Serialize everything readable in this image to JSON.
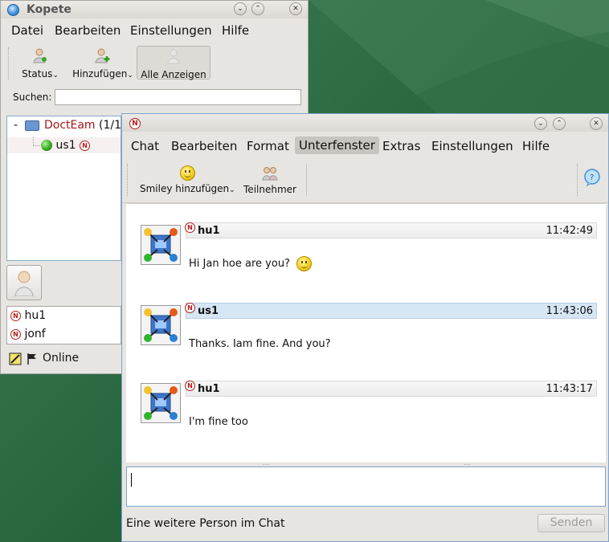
{
  "kopete": {
    "title": "Kopete",
    "menu": [
      "Datei",
      "Bearbeiten",
      "Einstellungen",
      "Hilfe"
    ],
    "toolbar": {
      "status": "Status",
      "add": "Hinzufügen",
      "show_all": "Alle Anzeigen"
    },
    "search_label": "Suchen:",
    "search_value": "",
    "group": {
      "expander": "-",
      "name": "DoctEam",
      "count": "(1/1)"
    },
    "contact": {
      "name": "us1"
    },
    "identities": [
      "hu1",
      "jonf"
    ],
    "status_text": "Online"
  },
  "chat": {
    "menu": [
      "Chat",
      "Bearbeiten",
      "Format",
      "Unterfenster",
      "Extras",
      "Einstellungen",
      "Hilfe"
    ],
    "active_menu": "Unterfenster",
    "toolbar": {
      "smiley": "Smiley hinzufügen",
      "participants": "Teilnehmer"
    },
    "messages": [
      {
        "sender": "hu1",
        "time": "11:42:49",
        "text": "Hi Jan hoe are you?",
        "has_smiley": true
      },
      {
        "sender": "us1",
        "time": "11:43:06",
        "text": "Thanks. Iam fine. And you?",
        "has_smiley": false
      },
      {
        "sender": "hu1",
        "time": "11:43:17",
        "text": "I'm fine too",
        "has_smiley": false
      }
    ],
    "status_text": "Eine weitere Person im Chat",
    "send_label": "Senden"
  }
}
